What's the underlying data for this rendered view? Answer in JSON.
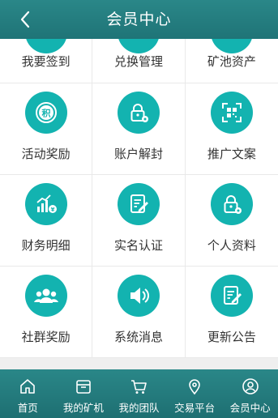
{
  "header": {
    "title": "会员中心"
  },
  "grid_rows": [
    [
      {
        "label": "我要签到",
        "icon": "checkin-icon"
      },
      {
        "label": "兑换管理",
        "icon": "exchange-icon"
      },
      {
        "label": "矿池资产",
        "icon": "assets-icon"
      }
    ],
    [
      {
        "label": "活动奖励",
        "icon": "points-badge-icon"
      },
      {
        "label": "账户解封",
        "icon": "unlock-gear-icon"
      },
      {
        "label": "推广文案",
        "icon": "qr-scan-icon"
      }
    ],
    [
      {
        "label": "财务明细",
        "icon": "finance-chart-icon"
      },
      {
        "label": "实名认证",
        "icon": "edit-document-icon"
      },
      {
        "label": "个人资料",
        "icon": "profile-lock-icon"
      }
    ],
    [
      {
        "label": "社群奖励",
        "icon": "community-icon"
      },
      {
        "label": "系统消息",
        "icon": "speaker-icon"
      },
      {
        "label": "更新公告",
        "icon": "announcement-edit-icon"
      }
    ]
  ],
  "badge_char": "积",
  "tabbar": [
    {
      "label": "首页",
      "icon": "home-icon"
    },
    {
      "label": "我的矿机",
      "icon": "miner-icon"
    },
    {
      "label": "我的团队",
      "icon": "cart-icon"
    },
    {
      "label": "交易平台",
      "icon": "location-pin-icon"
    },
    {
      "label": "会员中心",
      "icon": "user-circle-icon"
    }
  ],
  "colors": {
    "header": "#2a8788",
    "icon_circle": "#13b3b0",
    "label": "#333333"
  }
}
